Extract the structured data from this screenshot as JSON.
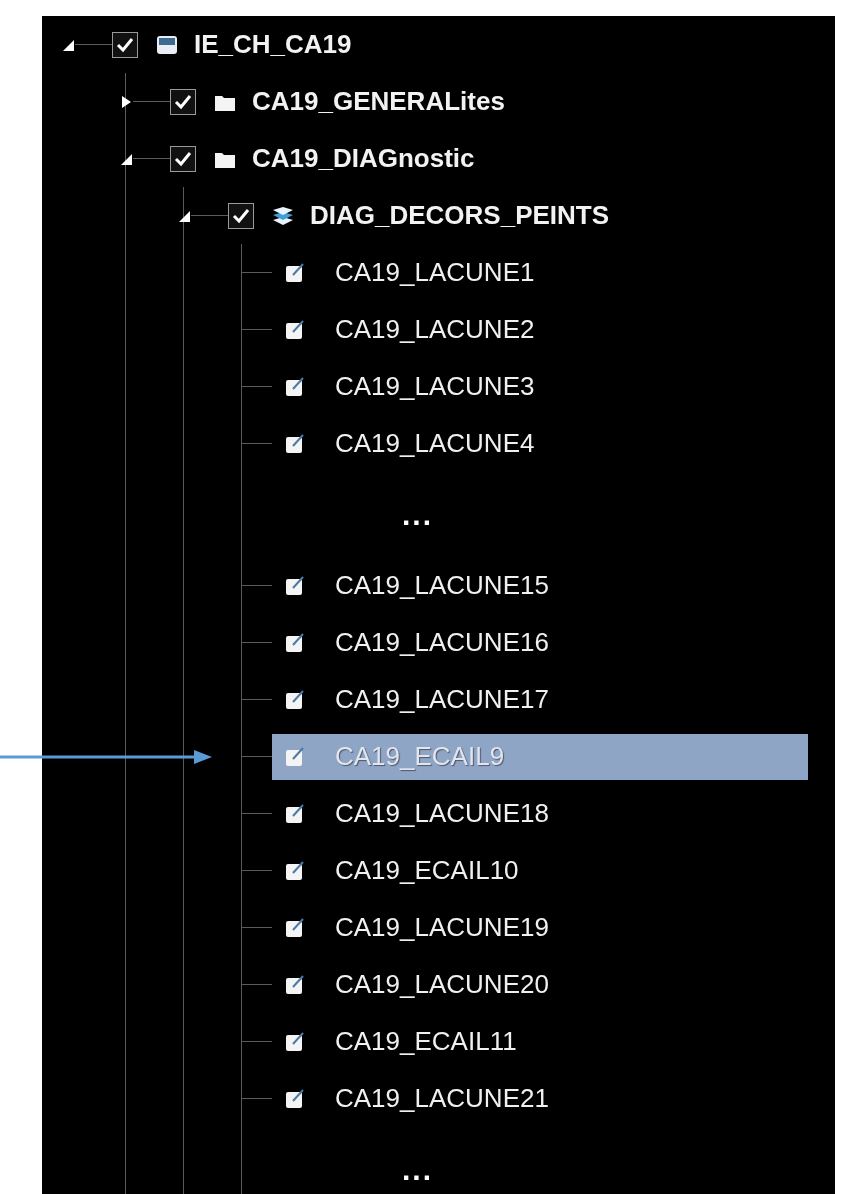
{
  "tree": [
    {
      "label": "IE_CH_CA19",
      "kind": "database",
      "checked": true,
      "expanded": true,
      "children": [
        {
          "label": "CA19_GENERALites",
          "kind": "folder",
          "checked": true,
          "expanded": false
        },
        {
          "label": "CA19_DIAGnostic",
          "kind": "folder",
          "checked": true,
          "expanded": true,
          "children": [
            {
              "label": "DIAG_DECORS_PEINTS",
              "kind": "layers",
              "checked": true,
              "expanded": true,
              "children": [
                {
                  "label": "CA19_LACUNE1",
                  "kind": "feature",
                  "selected": false
                },
                {
                  "label": "CA19_LACUNE2",
                  "kind": "feature",
                  "selected": false
                },
                {
                  "label": "CA19_LACUNE3",
                  "kind": "feature",
                  "selected": false
                },
                {
                  "label": "CA19_LACUNE4",
                  "kind": "feature",
                  "selected": false
                },
                {
                  "label": "...",
                  "kind": "more"
                },
                {
                  "label": "CA19_LACUNE15",
                  "kind": "feature",
                  "selected": false
                },
                {
                  "label": "CA19_LACUNE16",
                  "kind": "feature",
                  "selected": false
                },
                {
                  "label": "CA19_LACUNE17",
                  "kind": "feature",
                  "selected": false
                },
                {
                  "label": "CA19_ECAIL9",
                  "kind": "feature",
                  "selected": true
                },
                {
                  "label": "CA19_LACUNE18",
                  "kind": "feature",
                  "selected": false
                },
                {
                  "label": "CA19_ECAIL10",
                  "kind": "feature",
                  "selected": false
                },
                {
                  "label": "CA19_LACUNE19",
                  "kind": "feature",
                  "selected": false
                },
                {
                  "label": "CA19_LACUNE20",
                  "kind": "feature",
                  "selected": false
                },
                {
                  "label": "CA19_ECAIL11",
                  "kind": "feature",
                  "selected": false
                },
                {
                  "label": "CA19_LACUNE21",
                  "kind": "feature",
                  "selected": false
                },
                {
                  "label": "...",
                  "kind": "more"
                }
              ]
            }
          ]
        }
      ]
    }
  ]
}
